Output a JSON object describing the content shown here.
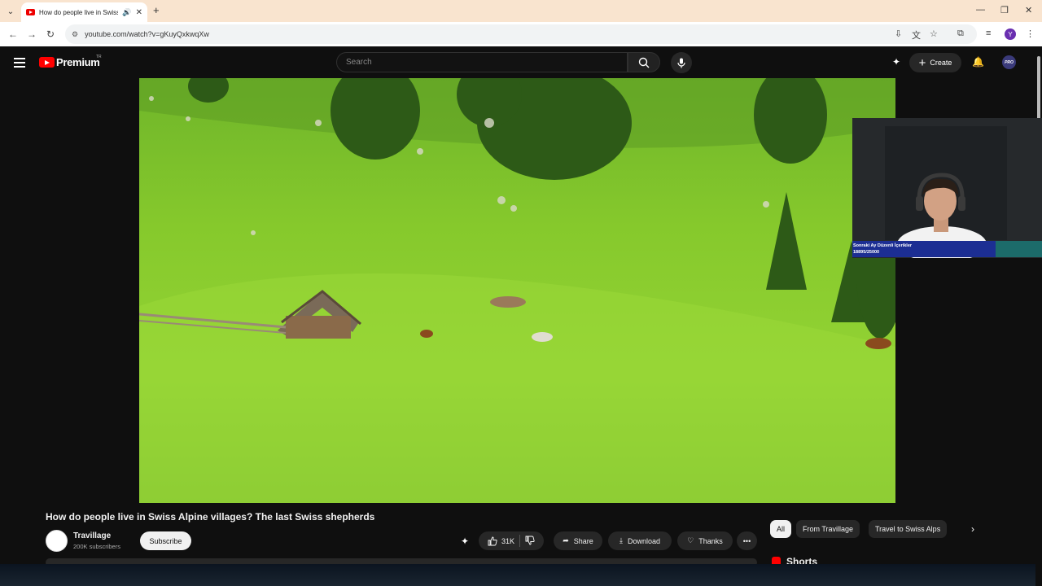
{
  "browser": {
    "tab_title": "How do people live in Swiss",
    "url": "youtube.com/watch?v=gKuyQxkwqXw",
    "profile_initial": "Y",
    "new_tab": "+",
    "close": "✕"
  },
  "header": {
    "logo_text": "Premium",
    "logo_region": "TR",
    "search_placeholder": "Search",
    "create_label": "Create",
    "account_badge": "PRO"
  },
  "overlay": {
    "line1": "Sonraki Ay Düzenli İçerikler",
    "line2": "18895/25000"
  },
  "video": {
    "title": "How do people live in Swiss Alpine villages? The last Swiss shepherds",
    "channel_name": "Travillage",
    "subscribers": "200K subscribers",
    "subscribe_label": "Subscribe",
    "likes": "31K",
    "share_label": "Share",
    "download_label": "Download",
    "thanks_label": "Thanks",
    "more_label": "•••"
  },
  "chips": [
    "All",
    "From Travillage",
    "Travel to Swiss Alps"
  ],
  "shorts_label": "Shorts",
  "colors": {
    "accent": "#ff0000",
    "bg": "#0f0f0f",
    "overlay_band": "#1c2e93"
  }
}
